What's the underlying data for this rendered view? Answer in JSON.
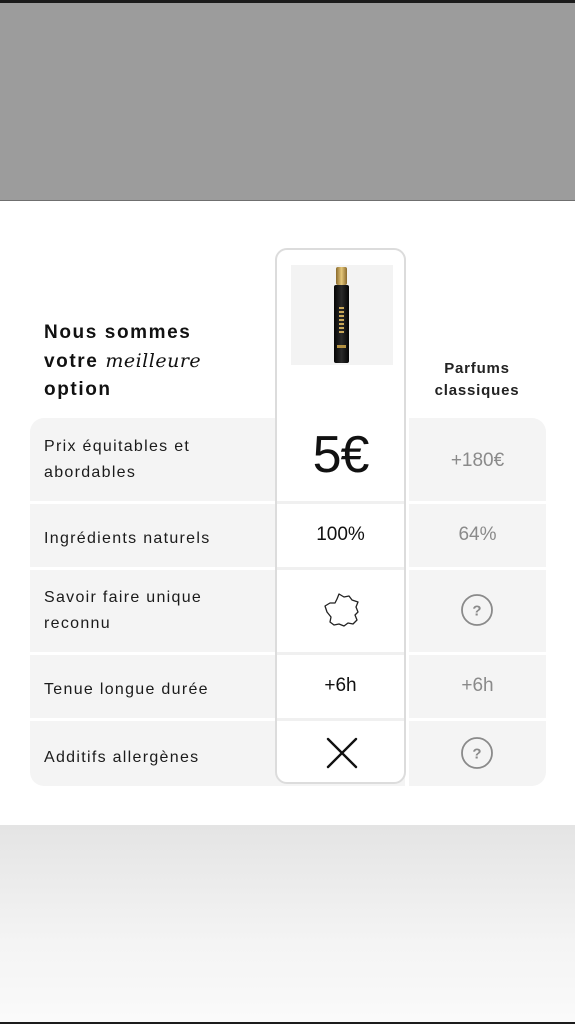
{
  "heading": {
    "line1": "Nous sommes",
    "line2_prefix": "votre ",
    "line2_accent": "meilleure",
    "line3": "option"
  },
  "product": {
    "bottle_text": "GRIS INTENSE"
  },
  "columns": {
    "others_line1": "Parfums",
    "others_line2": "classiques"
  },
  "rows": [
    {
      "label_line1": "Prix équitables et",
      "label_line2": "abordables",
      "ours": "5€",
      "theirs": "+180€"
    },
    {
      "label": "Ingrédients naturels",
      "ours": "100%",
      "theirs": "64%"
    },
    {
      "label_line1": "Savoir faire unique",
      "label_line2": "reconnu",
      "ours_icon": "france-map-icon",
      "theirs_icon": "question-icon"
    },
    {
      "label": "Tenue longue durée",
      "ours": "+6h",
      "theirs": "+6h"
    },
    {
      "label": "Additifs allergènes",
      "ours_icon": "cross-icon",
      "theirs_icon": "question-icon"
    }
  ],
  "colors": {
    "top_band": "#9c9c9c",
    "table_background": "#f4f4f4",
    "highlight_border": "#dcdcdc",
    "muted_text": "#8a8a8a"
  }
}
